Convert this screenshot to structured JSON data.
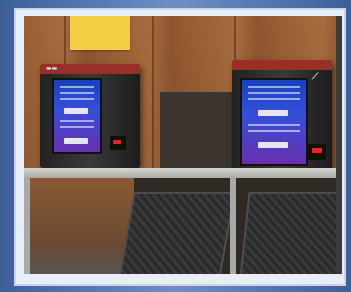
{
  "scene": {
    "subject": "kiosk-photo",
    "colors": {
      "frame": "#4a6aa0",
      "wall": "#9a5f35",
      "note": "#f2cf45",
      "screen": "#3350d8",
      "kiosk_top": "#9a2f2a"
    }
  }
}
